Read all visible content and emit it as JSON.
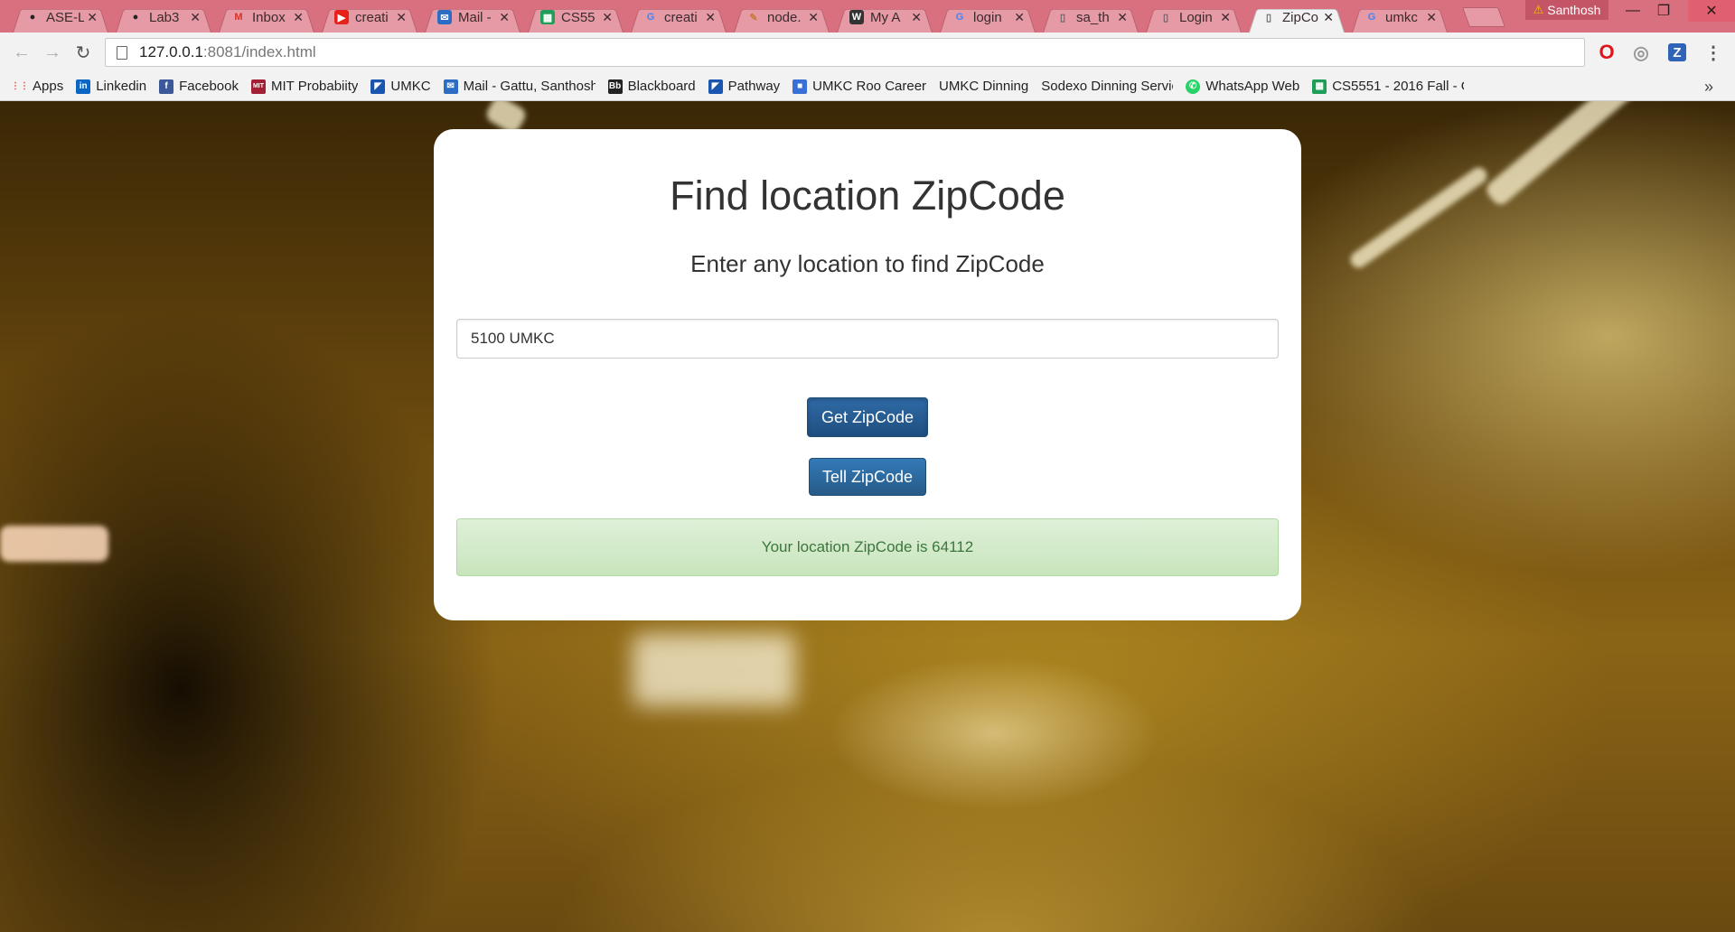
{
  "tabs": [
    {
      "label": "ASE-L",
      "icon": "github-icon"
    },
    {
      "label": "Lab3",
      "icon": "github-icon"
    },
    {
      "label": "Inbox",
      "icon": "gmail-icon"
    },
    {
      "label": "creati",
      "icon": "youtube-icon"
    },
    {
      "label": "Mail -",
      "icon": "mail-icon"
    },
    {
      "label": "CS55",
      "icon": "sheets-icon"
    },
    {
      "label": "creati",
      "icon": "google-icon"
    },
    {
      "label": "node.",
      "icon": "node-icon"
    },
    {
      "label": "My A",
      "icon": "ws-icon"
    },
    {
      "label": "login",
      "icon": "google-icon"
    },
    {
      "label": "sa_th",
      "icon": "page-icon"
    },
    {
      "label": "Login",
      "icon": "page-icon"
    },
    {
      "label": "ZipCo",
      "icon": "page-icon",
      "active": true
    },
    {
      "label": "umkc",
      "icon": "google-icon"
    }
  ],
  "profile": {
    "name": "Santhosh"
  },
  "toolbar": {
    "url_host": "127.0.0.1",
    "url_rest": ":8081/index.html"
  },
  "bookmarks": [
    {
      "label": "Apps",
      "icon": "apps-icon"
    },
    {
      "label": "Linkedin",
      "icon": "linkedin-icon"
    },
    {
      "label": "Facebook",
      "icon": "facebook-icon"
    },
    {
      "label": "MIT Probabiity",
      "icon": "mit-icon"
    },
    {
      "label": "UMKC",
      "icon": "umkc-icon"
    },
    {
      "label": "Mail - Gattu, Santhosh",
      "icon": "mail-icon"
    },
    {
      "label": "Blackboard",
      "icon": "blackboard-icon"
    },
    {
      "label": "Pathway",
      "icon": "umkc-icon"
    },
    {
      "label": "UMKC Roo Career",
      "icon": "roo-icon"
    },
    {
      "label": "UMKC Dinning",
      "icon": "page-icon"
    },
    {
      "label": "Sodexo Dinning Servic",
      "icon": "page-icon"
    },
    {
      "label": "WhatsApp Web",
      "icon": "whatsapp-icon"
    },
    {
      "label": "CS5551 - 2016 Fall - G",
      "icon": "sheets-icon"
    }
  ],
  "main": {
    "title": "Find location ZipCode",
    "subtitle": "Enter any location to find ZipCode",
    "location_value": "5100 UMKC",
    "get_button": "Get ZipCode",
    "tell_button": "Tell ZipCode",
    "result": "Your location ZipCode is 64112"
  },
  "colors": {
    "tabstrip": "#d9707f",
    "primary_button": "#337ab7",
    "success_bg": "#dff0d8",
    "success_text": "#3c763d"
  }
}
